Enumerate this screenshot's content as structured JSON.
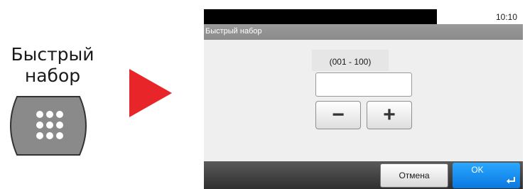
{
  "key": {
    "label_line1": "Быстрый",
    "label_line2": "набор"
  },
  "panel": {
    "clock": "10:10",
    "title": "Быстрый набор",
    "range": "(001 - 100)",
    "input_value": "",
    "minus_label": "−",
    "plus_label": "+",
    "cancel_label": "Отмена",
    "ok_label": "OK"
  },
  "colors": {
    "arrow": "#e8262a",
    "ok_button": "#1590f2",
    "hw_key": "#8a8a8a"
  },
  "icons": [
    "keypad-icon",
    "play-arrow-icon",
    "enter-icon"
  ]
}
